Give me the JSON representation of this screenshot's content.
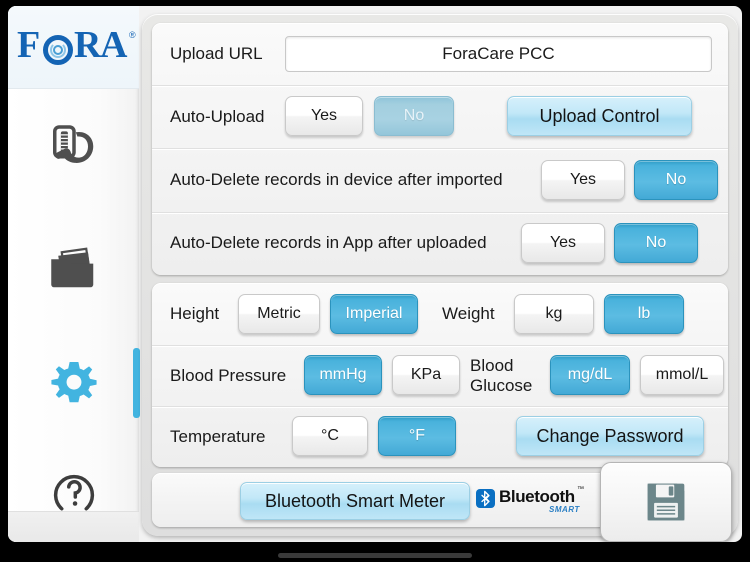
{
  "app": {
    "brand": "FORA",
    "brand_registered": "®",
    "accent_color": "#42b4e0",
    "brand_color": "#1464b4"
  },
  "sidebar": {
    "items": [
      {
        "name": "blood-pressure-monitor",
        "icon": "blood-pressure-monitor-icon",
        "active": false
      },
      {
        "name": "records",
        "icon": "folder-records-icon",
        "active": false
      },
      {
        "name": "settings",
        "icon": "gear-icon",
        "active": true
      },
      {
        "name": "help",
        "icon": "question-mark-icon",
        "active": false
      }
    ]
  },
  "upload_panel": {
    "rows": [
      {
        "label": "Upload URL",
        "input_value": "ForaCare PCC",
        "input_placeholder": "Upload URL"
      },
      {
        "label": "Auto-Upload",
        "options": [
          {
            "label": "Yes",
            "state": "off"
          },
          {
            "label": "No",
            "state": "on-muted"
          }
        ],
        "action": {
          "label": "Upload Control"
        }
      },
      {
        "label": "Auto-Delete records in device after imported",
        "options": [
          {
            "label": "Yes",
            "state": "off"
          },
          {
            "label": "No",
            "state": "on"
          }
        ]
      },
      {
        "label": "Auto-Delete records in App after uploaded",
        "options": [
          {
            "label": "Yes",
            "state": "off"
          },
          {
            "label": "No",
            "state": "on"
          }
        ]
      }
    ]
  },
  "units_panel": {
    "height": {
      "label": "Height",
      "options": [
        {
          "label": "Metric",
          "state": "off"
        },
        {
          "label": "Imperial",
          "state": "on"
        }
      ]
    },
    "weight": {
      "label": "Weight",
      "options": [
        {
          "label": "kg",
          "state": "off"
        },
        {
          "label": "lb",
          "state": "on"
        }
      ]
    },
    "blood_pressure": {
      "label": "Blood Pressure",
      "options": [
        {
          "label": "mmHg",
          "state": "on"
        },
        {
          "label": "KPa",
          "state": "off"
        }
      ]
    },
    "blood_glucose": {
      "label_line1": "Blood",
      "label_line2": "Glucose",
      "options": [
        {
          "label": "mg/dL",
          "state": "on"
        },
        {
          "label": "mmol/L",
          "state": "off"
        }
      ]
    },
    "temperature": {
      "label": "Temperature",
      "options": [
        {
          "label": "°C",
          "state": "off"
        },
        {
          "label": "°F",
          "state": "on"
        }
      ]
    },
    "change_password": {
      "label": "Change Password"
    }
  },
  "bottom_panel": {
    "bluetooth_meter_button": "Bluetooth Smart Meter",
    "bluetooth_logo": {
      "word": "Bluetooth",
      "trademark": "™",
      "sub": "SMART",
      "mark_color": "#0a6fc2"
    }
  },
  "save": {
    "icon": "floppy-disk-save-icon",
    "tooltip": "Save"
  }
}
